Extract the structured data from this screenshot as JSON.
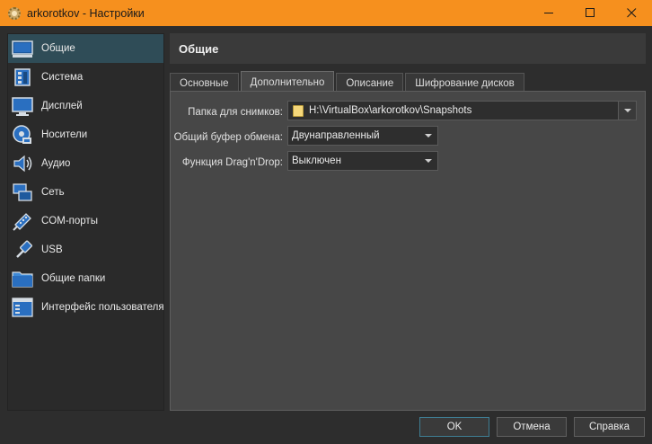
{
  "window": {
    "title": "arkorotkov - Настройки",
    "app_icon": "virtualbox-gear-icon",
    "controls": [
      "minimize-icon",
      "maximize-icon",
      "close-icon"
    ]
  },
  "sidebar": {
    "items": [
      {
        "label": "Общие",
        "icon": "general-icon",
        "active": true
      },
      {
        "label": "Система",
        "icon": "system-icon"
      },
      {
        "label": "Дисплей",
        "icon": "display-icon"
      },
      {
        "label": "Носители",
        "icon": "storage-icon"
      },
      {
        "label": "Аудио",
        "icon": "audio-icon"
      },
      {
        "label": "Сеть",
        "icon": "network-icon"
      },
      {
        "label": "COM-порты",
        "icon": "serial-ports-icon"
      },
      {
        "label": "USB",
        "icon": "usb-icon"
      },
      {
        "label": "Общие папки",
        "icon": "shared-folders-icon"
      },
      {
        "label": "Интерфейс пользователя",
        "icon": "user-interface-icon"
      }
    ]
  },
  "page": {
    "title": "Общие",
    "tabs": [
      {
        "label": "Основные"
      },
      {
        "label": "Дополнительно",
        "active": true
      },
      {
        "label": "Описание"
      },
      {
        "label": "Шифрование дисков"
      }
    ],
    "fields": {
      "snapshot_folder": {
        "label": "Папка для снимков:",
        "value": "H:\\VirtualBox\\arkorotkov\\Snapshots"
      },
      "clipboard": {
        "label": "Общий буфер обмена:",
        "value": "Двунаправленный"
      },
      "drag_drop": {
        "label": "Функция Drag'n'Drop:",
        "value": "Выключен"
      }
    }
  },
  "buttons": {
    "ok": "OK",
    "cancel": "Отмена",
    "help": "Справка"
  },
  "colors": {
    "titlebar": "#f6901e",
    "active_item": "#2f4c57",
    "accent": "#3f7d93"
  }
}
